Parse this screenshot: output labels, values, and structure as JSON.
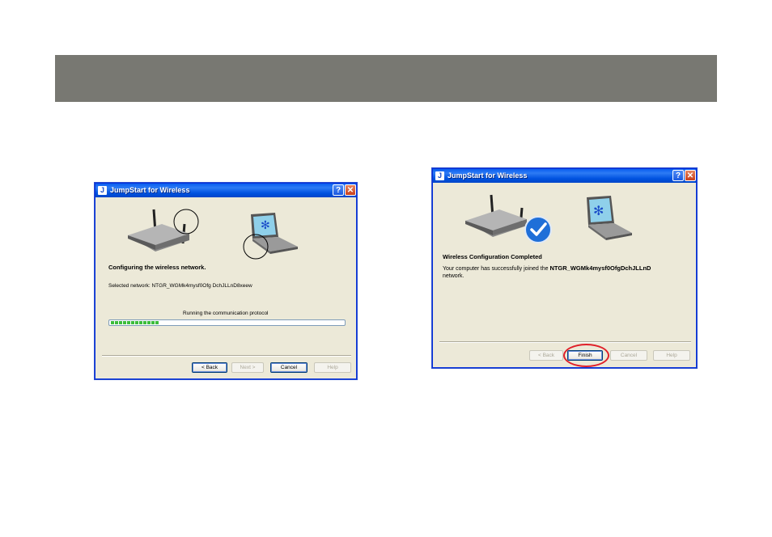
{
  "dialog1": {
    "title": "JumpStart for Wireless",
    "help_glyph": "?",
    "close_glyph": "✕",
    "status": "Configuring the wireless network.",
    "selected_network": "Selected network: NTGR_WGMk4mysf0Ofg DchJLLnD8xeew",
    "progress_label": "Running the communication protocol",
    "progress_segments": 12,
    "buttons": {
      "back": "< Back",
      "next": "Next >",
      "cancel": "Cancel",
      "help": "Help"
    }
  },
  "dialog2": {
    "title": "JumpStart for Wireless",
    "help_glyph": "?",
    "close_glyph": "✕",
    "heading": "Wireless Configuration Completed",
    "message_prefix": "Your computer has successfully joined the",
    "network_name": "NTGR_WGMk4mysf0OfgDchJLLnD",
    "message_suffix": "network.",
    "buttons": {
      "back": "< Back",
      "finish": "Finish",
      "cancel": "Cancel",
      "help": "Help"
    }
  },
  "colors": {
    "titlebar": "#0a5ef0",
    "dialog_bg": "#ece9d8",
    "header_bar": "#787872",
    "progress": "#3cbc3c",
    "highlight": "#e0202a"
  },
  "icons": [
    "router-icon",
    "laptop-icon",
    "checkmark-icon",
    "help-icon",
    "close-icon"
  ]
}
